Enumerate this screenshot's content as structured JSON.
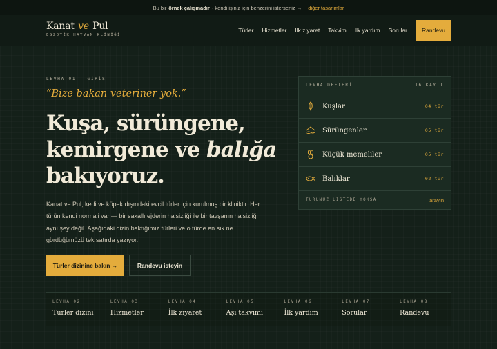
{
  "topbar": {
    "prefix": "Bu bir",
    "bold": "örnek çalışmadır",
    "suffix": "· kendi işiniz için benzerini isterseniz →",
    "link": "diğer tasarımlar"
  },
  "brand": {
    "name_part1": "Kanat",
    "name_connector": "ve",
    "name_part2": "Pul",
    "subtitle": "EGZOTİK HAYVAN KLİNİĞİ"
  },
  "nav": {
    "items": [
      "Türler",
      "Hizmetler",
      "İlk ziyaret",
      "Takvim",
      "İlk yardım",
      "Sorular"
    ],
    "cta": "Randevu"
  },
  "hero": {
    "eyebrow": "LEVHA 01 · GİRİŞ",
    "quote": "“Bize bakan veteriner yok.”",
    "headline_line1": "Kuşa, sürüngene,",
    "headline_line2_pre": "kemirgene ve ",
    "headline_line2_em": "balığa",
    "headline_line3": "bakıyoruz.",
    "intro": "Kanat ve Pul, kedi ve köpek dışındaki evcil türler için kurulmuş bir kliniktir. Her türün kendi normali var — bir sakallı ejderin halsizliği ile bir tavşanın halsizliği aynı şey değil. Aşağıdaki dizin baktığımız türleri ve o türde en sık ne gördüğümüzü tek satırda yazıyor.",
    "primary_button": "Türler dizinine bakın →",
    "secondary_button": "Randevu isteyin"
  },
  "registry": {
    "title": "LEVHA DEFTERİ",
    "count": "16 KAYIT",
    "rows": [
      {
        "icon": "feather-icon",
        "label": "Kuşlar",
        "count": "04 tür"
      },
      {
        "icon": "dunes-icon",
        "label": "Sürüngenler",
        "count": "05 tür"
      },
      {
        "icon": "rabbit-icon",
        "label": "Küçük memeliler",
        "count": "05 tür"
      },
      {
        "icon": "fish-icon",
        "label": "Balıklar",
        "count": "02 tür"
      }
    ],
    "footer_note": "TÜRÜNÜZ LİSTEDE YOKSA",
    "footer_link": "arayın"
  },
  "index": [
    {
      "num": "LEVHA 02",
      "title": "Türler dizini"
    },
    {
      "num": "LEVHA 03",
      "title": "Hizmetler"
    },
    {
      "num": "LEVHA 04",
      "title": "İlk ziyaret"
    },
    {
      "num": "LEVHA 05",
      "title": "Aşı takvimi"
    },
    {
      "num": "LEVHA 06",
      "title": "İlk yardım"
    },
    {
      "num": "LEVHA 07",
      "title": "Sorular"
    },
    {
      "num": "LEVHA 08",
      "title": "Randevu"
    }
  ],
  "colors": {
    "background": "#142019",
    "accent": "#e4ac3c",
    "text": "#f1ead8",
    "panel": "#1b2b22"
  }
}
